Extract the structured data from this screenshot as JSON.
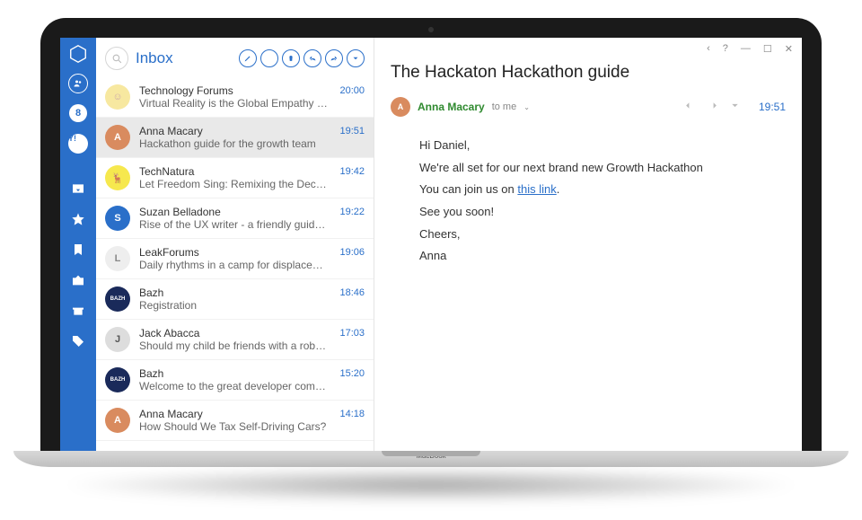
{
  "rail": {
    "google": "8",
    "yahoo": "Y!"
  },
  "list": {
    "folder": "Inbox",
    "messages": [
      {
        "sender": "Technology Forums",
        "subject": "Virtual Reality is the Global Empathy Ma…",
        "time": "20:00",
        "avatar_bg": "#f7e8a0",
        "avatar_fg": "#caa",
        "initials": "☺"
      },
      {
        "sender": "Anna Macary",
        "subject": "Hackathon guide for the growth team",
        "time": "19:51",
        "avatar_bg": "#d98b5f",
        "avatar_fg": "#fff",
        "initials": "A",
        "selected": true
      },
      {
        "sender": "TechNatura",
        "subject": "Let Freedom Sing: Remixing the Declarati…",
        "time": "19:42",
        "avatar_bg": "#f6e84e",
        "avatar_fg": "#333",
        "initials": "🦌"
      },
      {
        "sender": "Suzan Belladone",
        "subject": "Rise of the UX writer - a friendly guide of…",
        "time": "19:22",
        "avatar_bg": "#2a6fc9",
        "avatar_fg": "#fff",
        "initials": "S"
      },
      {
        "sender": "LeakForums",
        "subject": "Daily rhythms in a camp for displaced pe…",
        "time": "19:06",
        "avatar_bg": "#eee",
        "avatar_fg": "#888",
        "initials": "L"
      },
      {
        "sender": "Bazh",
        "subject": "Registration",
        "time": "18:46",
        "avatar_bg": "#1a2a5a",
        "avatar_fg": "#fff",
        "initials": "BAZH"
      },
      {
        "sender": "Jack Abacca",
        "subject": "Should my child be friends with a robot…",
        "time": "17:03",
        "avatar_bg": "#ddd",
        "avatar_fg": "#555",
        "initials": "J"
      },
      {
        "sender": "Bazh",
        "subject": "Welcome to the great developer commu…",
        "time": "15:20",
        "avatar_bg": "#1a2a5a",
        "avatar_fg": "#fff",
        "initials": "BAZH"
      },
      {
        "sender": "Anna Macary",
        "subject": "How Should We Tax Self-Driving Cars?",
        "time": "14:18",
        "avatar_bg": "#d98b5f",
        "avatar_fg": "#fff",
        "initials": "A"
      }
    ]
  },
  "pane": {
    "title": "The Hackaton Hackathon guide",
    "from": "Anna Macary",
    "to": "to me",
    "time": "19:51",
    "body": {
      "l1": "Hi Daniel,",
      "l2_a": "We're all set for our next brand new Growth Hackathon",
      "l3_a": "You can join us on ",
      "l3_link": "this link",
      "l3_b": ".",
      "l4": "See you soon!",
      "l5": "Cheers,",
      "l6": "Anna"
    }
  },
  "window": {
    "back": "‹",
    "help": "?",
    "min": "—",
    "max": "☐",
    "close": "✕"
  },
  "laptop": {
    "brand": "MacBook"
  }
}
